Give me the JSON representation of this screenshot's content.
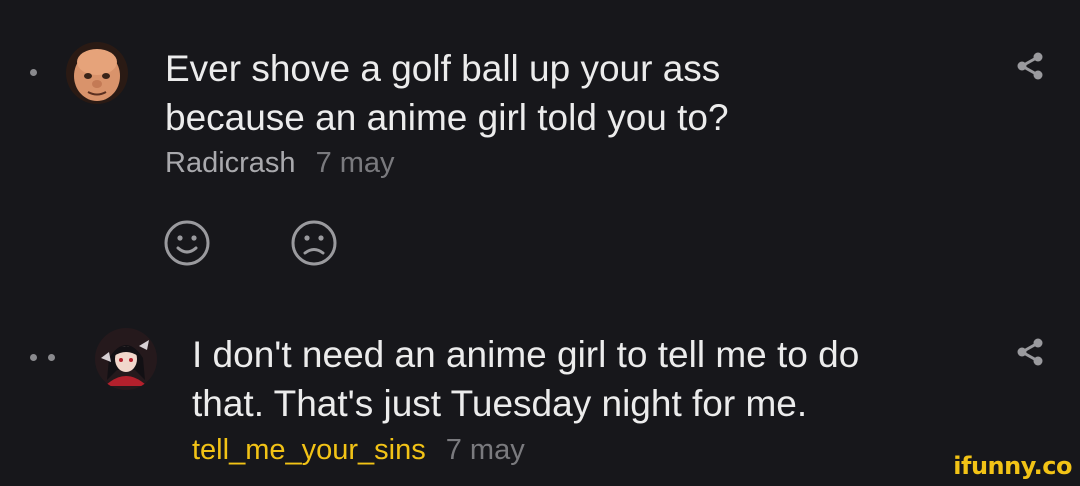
{
  "comments": [
    {
      "text_line1": "Ever shove a golf ball up your ass",
      "text_line2": "because an anime girl told you to?",
      "author": "Radicrash",
      "date": "7 may",
      "avatar_icon": "bald-cartoon-character-avatar",
      "reactions": [
        "smile-icon",
        "frown-icon"
      ]
    },
    {
      "text_line1": "I don't need an anime girl to tell me to do",
      "text_line2": "that. That's just Tuesday night for me.",
      "author": "tell_me_your_sins",
      "date": "7 may",
      "avatar_icon": "anime-girl-avatar"
    }
  ],
  "watermark": "ifunny.co",
  "colors": {
    "background": "#17171b",
    "text": "#ececec",
    "author_reply": "#f2c316",
    "author": "#a9a9ad",
    "date": "#7a7a7e",
    "icon": "#9a9a9e"
  }
}
